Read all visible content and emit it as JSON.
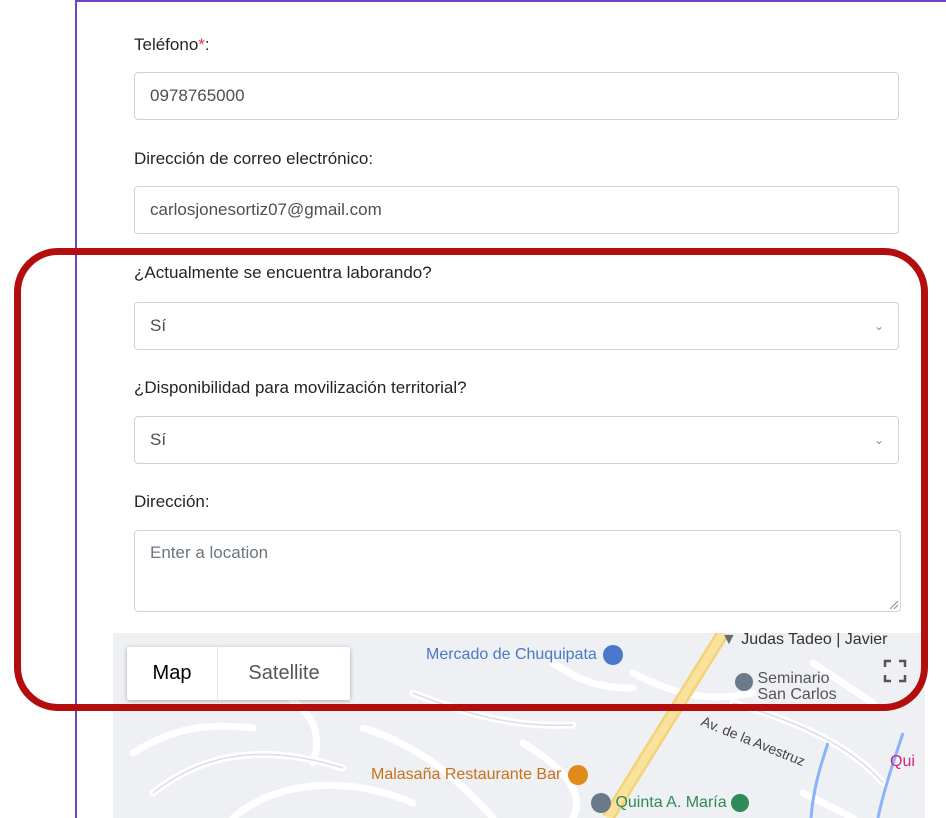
{
  "form": {
    "phone_label": "Teléfono",
    "required_mark": "*",
    "label_colon": ":",
    "phone_value": "0978765000",
    "email_label": "Dirección de correo electrónico:",
    "email_value": "carlosjonesortiz07@gmail.com",
    "working_label": "¿Actualmente se encuentra laborando?",
    "working_value": "Sí",
    "mobility_label": "¿Disponibilidad para movilización territorial?",
    "mobility_value": "Sí",
    "address_label": "Dirección:",
    "address_placeholder": "Enter a location"
  },
  "map": {
    "map_button": "Map",
    "satellite_button": "Satellite",
    "places": {
      "market": "Mercado de Chuquipata",
      "judas": "Judas Tadeo | Javier",
      "seminario_1": "Seminario",
      "seminario_2": "San Carlos",
      "street": "Av. de la Avestruz",
      "restaurant": "Malasaña Restaurante Bar",
      "quinta": "Quinta A. María",
      "qui": "Qui"
    }
  },
  "colors": {
    "highlight": "#b30d0d",
    "frame": "#6f42c1",
    "poi_blue": "#4a78c8",
    "poi_orange": "#c5721a",
    "poi_green": "#2e8b57"
  }
}
